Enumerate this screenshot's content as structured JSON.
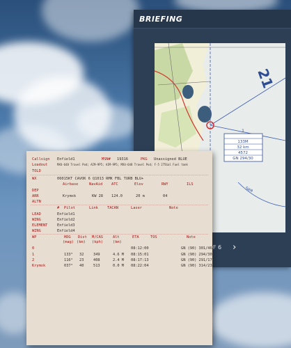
{
  "briefing": {
    "title": "BRIEFING",
    "pager": {
      "prev_icon": "chevron-left-icon",
      "next_icon": "chevron-right-icon",
      "text": "4 OF 6"
    }
  },
  "map": {
    "box_lines": [
      "1",
      "133M",
      "32 km",
      "4572",
      "GN 294/30"
    ]
  },
  "kneeboard": {
    "callsign_label": "Callsign",
    "callsign": "Enfield1",
    "msn_label": "MSN#",
    "msn": "19316",
    "pkg_label": "PKG",
    "pkg": "Unassigned BLUE",
    "loadout_label": "Loadout",
    "loadout": "MXU-648 Travel Pod; AIM-9P5; AIM-9P5; MXU-648 Travel Pod; F-5 275Gal Fuel tank",
    "told_label": "TOLD",
    "wx_label": "WX",
    "wx": "06015KT CAVOK 6 Q1013 RMK FBL TURB BLU+",
    "airfield_headers": [
      "Airbase",
      "NavAid",
      "ATC",
      "Elev",
      "RWY",
      "ILS"
    ],
    "dep_label": "DEP",
    "arr_label": "ARR",
    "arr": [
      "Krymsk",
      "KW 28",
      "124.0",
      "20 m",
      "04",
      ""
    ],
    "altn_label": "ALTN",
    "flight_headers": [
      "#",
      "Pilot",
      "Link",
      "TACAN",
      "Laser",
      "Note"
    ],
    "flight": [
      {
        "role": "LEAD",
        "pilot": "Enfield1"
      },
      {
        "role": "WING",
        "pilot": "Enfield2"
      },
      {
        "role": "ELEMENT",
        "pilot": "Enfield3"
      },
      {
        "role": "WING",
        "pilot": "Enfield4"
      }
    ],
    "wp_headers": [
      "WP",
      "HDG",
      "Dist",
      "M/CAS",
      "Alt",
      "ETA",
      "TOS",
      "Note"
    ],
    "wp_subheaders": [
      "(mag)",
      "(km)",
      "(kph)",
      "(km)"
    ],
    "waypoints": [
      {
        "wp": "0",
        "hdg": "",
        "dist": "",
        "cas": "",
        "alt": "",
        "eta": "08:12:00",
        "tos": "",
        "note": "GN (90) 301/46"
      },
      {
        "wp": "1",
        "hdg": "133°",
        "dist": "32",
        "cas": "349",
        "alt": "4.6 M",
        "eta": "08:15:01",
        "tos": "",
        "note": "GN (90) 294/30"
      },
      {
        "wp": "2",
        "hdg": "116°",
        "dist": "23",
        "cas": "408",
        "alt": "2.4 M",
        "eta": "08:17:13",
        "tos": "",
        "note": "GN (90) 291/17"
      },
      {
        "wp": "Krymsk",
        "hdg": "037°",
        "dist": "40",
        "cas": "513",
        "alt": "0.0 M",
        "eta": "08:22:04",
        "tos": "",
        "note": "GN (90) 314/23"
      }
    ]
  }
}
